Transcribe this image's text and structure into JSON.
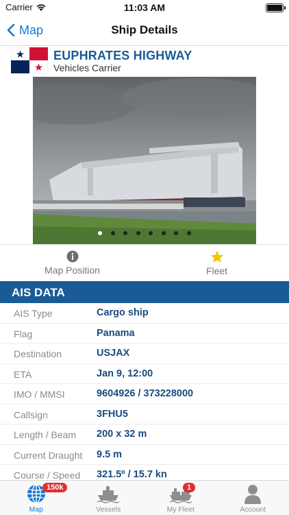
{
  "status_bar": {
    "carrier": "Carrier",
    "time": "11:03 AM"
  },
  "nav": {
    "back_label": "Map",
    "title": "Ship Details"
  },
  "ship": {
    "name": "EUPHRATES HIGHWAY",
    "type": "Vehicles Carrier",
    "flag_icon": "panama-flag-icon"
  },
  "gallery": {
    "image_count": 8,
    "active_index": 0
  },
  "actions": [
    {
      "label": "Map Position",
      "icon": "info-icon"
    },
    {
      "label": "Fleet",
      "icon": "star-icon"
    }
  ],
  "ais": {
    "title": "AIS DATA",
    "rows": [
      {
        "key": "AIS Type",
        "value": "Cargo ship"
      },
      {
        "key": "Flag",
        "value": "Panama"
      },
      {
        "key": "Destination",
        "value": "USJAX"
      },
      {
        "key": "ETA",
        "value": "Jan 9, 12:00"
      },
      {
        "key": "IMO / MMSI",
        "value": "9604926 / 373228000"
      },
      {
        "key": "Callsign",
        "value": "3FHU5"
      },
      {
        "key": "Length / Beam",
        "value": "200 x 32 m"
      },
      {
        "key": "Current Draught",
        "value": "9.5 m"
      },
      {
        "key": "Course / Speed",
        "value": "321.5º / 15.7 kn"
      }
    ]
  },
  "tabs": [
    {
      "label": "Map",
      "badge": "150k",
      "icon": "globe-icon"
    },
    {
      "label": "Vessels",
      "badge": "",
      "icon": "ship-icon"
    },
    {
      "label": "My Fleet",
      "badge": "1",
      "icon": "fleet-icon"
    },
    {
      "label": "Account",
      "badge": "",
      "icon": "person-icon"
    }
  ],
  "colors": {
    "accent": "#1577d3",
    "section_bg": "#1a5b96",
    "value_text": "#1a4a80",
    "badge": "#e02e2e"
  }
}
